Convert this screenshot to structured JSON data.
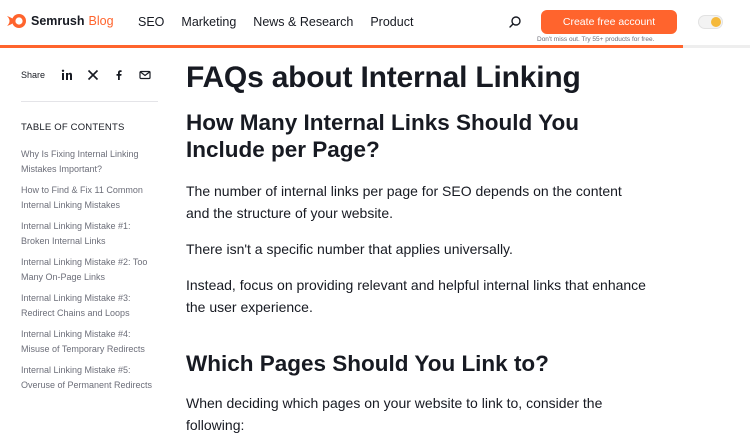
{
  "header": {
    "brand": "Semrush",
    "brand_suffix": "Blog",
    "nav": [
      "SEO",
      "Marketing",
      "News & Research",
      "Product"
    ],
    "cta_label": "Create free account",
    "cta_subtext": "Don't miss out. Try 55+ products for free.",
    "accent_color": "#ff642d",
    "reading_progress": 0.91
  },
  "sidebar": {
    "share_label": "Share",
    "share_icons": [
      "linkedin-icon",
      "x-icon",
      "facebook-icon",
      "email-icon"
    ],
    "toc_title": "TABLE OF CONTENTS",
    "toc_items": [
      "Why Is Fixing Internal Linking Mistakes Important?",
      "How to Find & Fix 11 Common Internal Linking Mistakes",
      "Internal Linking Mistake #1: Broken Internal Links",
      "Internal Linking Mistake #2: Too Many On-Page Links",
      "Internal Linking Mistake #3: Redirect Chains and Loops",
      "Internal Linking Mistake #4: Misuse of Temporary Redirects",
      "Internal Linking Mistake #5: Overuse of Permanent Redirects"
    ]
  },
  "article": {
    "h1": "FAQs about Internal Linking",
    "h2_1": "How Many Internal Links Should You Include per Page?",
    "p1": "The number of internal links per page for SEO depends on the content and the structure of your website.",
    "p2": "There isn't a specific number that applies universally.",
    "p3": "Instead, focus on providing relevant and helpful internal links that enhance the user experience.",
    "h2_2": "Which Pages Should You Link to?",
    "p4": "When deciding which pages on your website to link to, consider the following:"
  }
}
